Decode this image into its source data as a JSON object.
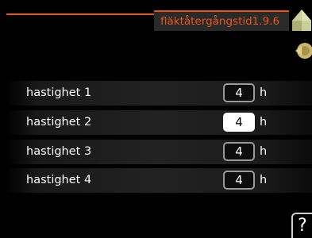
{
  "header": {
    "title": "fläktåtergångstid1.9.6",
    "accent_color": "#e8551a",
    "icons": [
      "home-icon",
      "back-icon"
    ]
  },
  "rows": [
    {
      "label": "hastighet 1",
      "value": "4",
      "unit": "h",
      "selected": false
    },
    {
      "label": "hastighet 2",
      "value": "4",
      "unit": "h",
      "selected": true
    },
    {
      "label": "hastighet 3",
      "value": "4",
      "unit": "h",
      "selected": false
    },
    {
      "label": "hastighet 4",
      "value": "4",
      "unit": "h",
      "selected": false
    }
  ],
  "help": {
    "label": "?"
  }
}
